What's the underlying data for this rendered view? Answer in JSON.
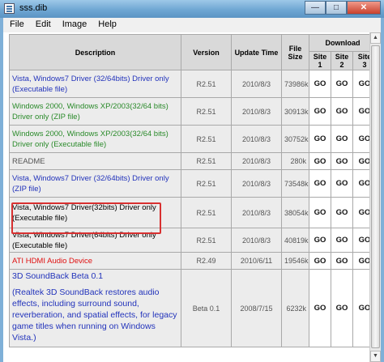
{
  "window": {
    "title": "sss.dib"
  },
  "menu": [
    "File",
    "Edit",
    "Image",
    "Help"
  ],
  "table": {
    "headers": {
      "description": "Description",
      "version": "Version",
      "update": "Update Time",
      "size": "File Size",
      "download": "Download",
      "site1": "Site 1",
      "site2": "Site 2",
      "site3": "Site 3"
    },
    "rows": [
      {
        "description": "Vista, Windows7 Driver (32/64bits) Driver only (Executable file)",
        "color": "#2233bb",
        "version": "R2.51",
        "update": "2010/8/3",
        "size": "73986k",
        "go1": "GO",
        "go2": "GO",
        "go3": "GO"
      },
      {
        "description": "Windows 2000, Windows XP/2003(32/64 bits) Driver only (ZIP file)",
        "color": "#2a8a2a",
        "version": "R2.51",
        "update": "2010/8/3",
        "size": "30913k",
        "go1": "GO",
        "go2": "GO",
        "go3": "GO"
      },
      {
        "description": "Windows 2000, Windows XP/2003(32/64 bits) Driver only (Executable file)",
        "color": "#2a8a2a",
        "version": "R2.51",
        "update": "2010/8/3",
        "size": "30752k",
        "go1": "GO",
        "go2": "GO",
        "go3": "GO"
      },
      {
        "description": "README",
        "color": "#555555",
        "version": "R2.51",
        "update": "2010/8/3",
        "size": "280k",
        "go1": "GO",
        "go2": "GO",
        "go3": "GO"
      },
      {
        "description": "Vista, Windows7 Driver (32/64bits) Driver only (ZIP file)",
        "color": "#2233bb",
        "version": "R2.51",
        "update": "2010/8/3",
        "size": "73548k",
        "go1": "GO",
        "go2": "GO",
        "go3": "GO"
      },
      {
        "description": "Vista, Windows7 Driver(32bits) Driver only (Executable file)",
        "color": "#000000",
        "version": "R2.51",
        "update": "2010/8/3",
        "size": "38054k",
        "go1": "GO",
        "go2": "GO",
        "go3": "GO"
      },
      {
        "description": "Vista, Windows7 Driver(64bits) Driver only (Executable file)",
        "color": "#000000",
        "version": "R2.51",
        "update": "2010/8/3",
        "size": "40819k",
        "go1": "GO",
        "go2": "GO",
        "go3": "GO"
      },
      {
        "description": "ATI HDMI Audio Device",
        "color": "#e01010",
        "version": "R2.49",
        "update": "2010/6/11",
        "size": "19546k",
        "go1": "GO",
        "go2": "GO",
        "go3": "GO"
      },
      {
        "description_title": "3D SoundBack Beta 0.1",
        "description_body": "(Realtek 3D SoundBack restores audio effects, including surround sound, reverberation, and spatial effects, for legacy game titles when running on Windows Vista.)",
        "color": "#2233bb",
        "version": "Beta 0.1",
        "update": "2008/7/15",
        "size": "6232k",
        "go1": "GO",
        "go2": "GO",
        "go3": "GO"
      }
    ]
  }
}
